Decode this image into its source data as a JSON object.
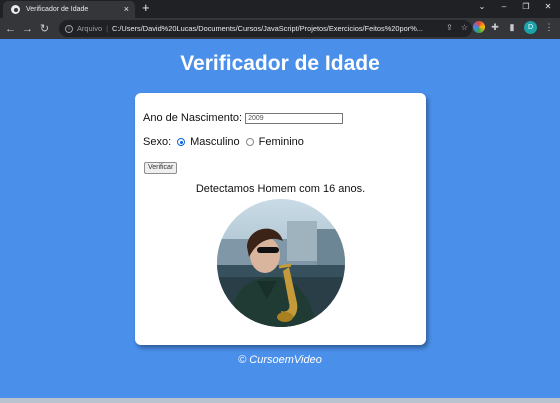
{
  "browser": {
    "tab_title": "Verificador de Idade",
    "tab_close": "×",
    "new_tab": "+",
    "address_scheme": "Arquivo",
    "address_url": "C:/Users/David%20Lucas/Documents/Cursos/JavaScript/Projetos/Exercicios/Feitos%20por%...",
    "profile_initial": "D"
  },
  "page": {
    "title": "Verificador de Idade",
    "birth_label": "Ano de Nascimento:",
    "birth_value": "2009",
    "sex_label": "Sexo:",
    "sex_options": [
      {
        "label": "Masculino",
        "checked": true
      },
      {
        "label": "Feminino",
        "checked": false
      }
    ],
    "button_label": "Verificar",
    "result_text": "Detectamos Homem com 16 anos.",
    "credit": "© CursoemVideo"
  },
  "colors": {
    "page_bg": "#4a8fea",
    "card_bg": "#ffffff",
    "accent": "#0a66d8"
  }
}
